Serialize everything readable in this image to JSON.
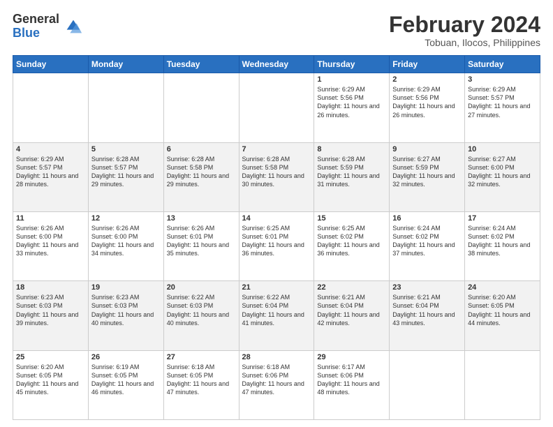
{
  "logo": {
    "general": "General",
    "blue": "Blue"
  },
  "header": {
    "month": "February 2024",
    "location": "Tobuan, Ilocos, Philippines"
  },
  "weekdays": [
    "Sunday",
    "Monday",
    "Tuesday",
    "Wednesday",
    "Thursday",
    "Friday",
    "Saturday"
  ],
  "weeks": [
    [
      {
        "day": "",
        "sunrise": "",
        "sunset": "",
        "daylight": ""
      },
      {
        "day": "",
        "sunrise": "",
        "sunset": "",
        "daylight": ""
      },
      {
        "day": "",
        "sunrise": "",
        "sunset": "",
        "daylight": ""
      },
      {
        "day": "",
        "sunrise": "",
        "sunset": "",
        "daylight": ""
      },
      {
        "day": "1",
        "sunrise": "Sunrise: 6:29 AM",
        "sunset": "Sunset: 5:56 PM",
        "daylight": "Daylight: 11 hours and 26 minutes."
      },
      {
        "day": "2",
        "sunrise": "Sunrise: 6:29 AM",
        "sunset": "Sunset: 5:56 PM",
        "daylight": "Daylight: 11 hours and 26 minutes."
      },
      {
        "day": "3",
        "sunrise": "Sunrise: 6:29 AM",
        "sunset": "Sunset: 5:57 PM",
        "daylight": "Daylight: 11 hours and 27 minutes."
      }
    ],
    [
      {
        "day": "4",
        "sunrise": "Sunrise: 6:29 AM",
        "sunset": "Sunset: 5:57 PM",
        "daylight": "Daylight: 11 hours and 28 minutes."
      },
      {
        "day": "5",
        "sunrise": "Sunrise: 6:28 AM",
        "sunset": "Sunset: 5:57 PM",
        "daylight": "Daylight: 11 hours and 29 minutes."
      },
      {
        "day": "6",
        "sunrise": "Sunrise: 6:28 AM",
        "sunset": "Sunset: 5:58 PM",
        "daylight": "Daylight: 11 hours and 29 minutes."
      },
      {
        "day": "7",
        "sunrise": "Sunrise: 6:28 AM",
        "sunset": "Sunset: 5:58 PM",
        "daylight": "Daylight: 11 hours and 30 minutes."
      },
      {
        "day": "8",
        "sunrise": "Sunrise: 6:28 AM",
        "sunset": "Sunset: 5:59 PM",
        "daylight": "Daylight: 11 hours and 31 minutes."
      },
      {
        "day": "9",
        "sunrise": "Sunrise: 6:27 AM",
        "sunset": "Sunset: 5:59 PM",
        "daylight": "Daylight: 11 hours and 32 minutes."
      },
      {
        "day": "10",
        "sunrise": "Sunrise: 6:27 AM",
        "sunset": "Sunset: 6:00 PM",
        "daylight": "Daylight: 11 hours and 32 minutes."
      }
    ],
    [
      {
        "day": "11",
        "sunrise": "Sunrise: 6:26 AM",
        "sunset": "Sunset: 6:00 PM",
        "daylight": "Daylight: 11 hours and 33 minutes."
      },
      {
        "day": "12",
        "sunrise": "Sunrise: 6:26 AM",
        "sunset": "Sunset: 6:00 PM",
        "daylight": "Daylight: 11 hours and 34 minutes."
      },
      {
        "day": "13",
        "sunrise": "Sunrise: 6:26 AM",
        "sunset": "Sunset: 6:01 PM",
        "daylight": "Daylight: 11 hours and 35 minutes."
      },
      {
        "day": "14",
        "sunrise": "Sunrise: 6:25 AM",
        "sunset": "Sunset: 6:01 PM",
        "daylight": "Daylight: 11 hours and 36 minutes."
      },
      {
        "day": "15",
        "sunrise": "Sunrise: 6:25 AM",
        "sunset": "Sunset: 6:02 PM",
        "daylight": "Daylight: 11 hours and 36 minutes."
      },
      {
        "day": "16",
        "sunrise": "Sunrise: 6:24 AM",
        "sunset": "Sunset: 6:02 PM",
        "daylight": "Daylight: 11 hours and 37 minutes."
      },
      {
        "day": "17",
        "sunrise": "Sunrise: 6:24 AM",
        "sunset": "Sunset: 6:02 PM",
        "daylight": "Daylight: 11 hours and 38 minutes."
      }
    ],
    [
      {
        "day": "18",
        "sunrise": "Sunrise: 6:23 AM",
        "sunset": "Sunset: 6:03 PM",
        "daylight": "Daylight: 11 hours and 39 minutes."
      },
      {
        "day": "19",
        "sunrise": "Sunrise: 6:23 AM",
        "sunset": "Sunset: 6:03 PM",
        "daylight": "Daylight: 11 hours and 40 minutes."
      },
      {
        "day": "20",
        "sunrise": "Sunrise: 6:22 AM",
        "sunset": "Sunset: 6:03 PM",
        "daylight": "Daylight: 11 hours and 40 minutes."
      },
      {
        "day": "21",
        "sunrise": "Sunrise: 6:22 AM",
        "sunset": "Sunset: 6:04 PM",
        "daylight": "Daylight: 11 hours and 41 minutes."
      },
      {
        "day": "22",
        "sunrise": "Sunrise: 6:21 AM",
        "sunset": "Sunset: 6:04 PM",
        "daylight": "Daylight: 11 hours and 42 minutes."
      },
      {
        "day": "23",
        "sunrise": "Sunrise: 6:21 AM",
        "sunset": "Sunset: 6:04 PM",
        "daylight": "Daylight: 11 hours and 43 minutes."
      },
      {
        "day": "24",
        "sunrise": "Sunrise: 6:20 AM",
        "sunset": "Sunset: 6:05 PM",
        "daylight": "Daylight: 11 hours and 44 minutes."
      }
    ],
    [
      {
        "day": "25",
        "sunrise": "Sunrise: 6:20 AM",
        "sunset": "Sunset: 6:05 PM",
        "daylight": "Daylight: 11 hours and 45 minutes."
      },
      {
        "day": "26",
        "sunrise": "Sunrise: 6:19 AM",
        "sunset": "Sunset: 6:05 PM",
        "daylight": "Daylight: 11 hours and 46 minutes."
      },
      {
        "day": "27",
        "sunrise": "Sunrise: 6:18 AM",
        "sunset": "Sunset: 6:05 PM",
        "daylight": "Daylight: 11 hours and 47 minutes."
      },
      {
        "day": "28",
        "sunrise": "Sunrise: 6:18 AM",
        "sunset": "Sunset: 6:06 PM",
        "daylight": "Daylight: 11 hours and 47 minutes."
      },
      {
        "day": "29",
        "sunrise": "Sunrise: 6:17 AM",
        "sunset": "Sunset: 6:06 PM",
        "daylight": "Daylight: 11 hours and 48 minutes."
      },
      {
        "day": "",
        "sunrise": "",
        "sunset": "",
        "daylight": ""
      },
      {
        "day": "",
        "sunrise": "",
        "sunset": "",
        "daylight": ""
      }
    ]
  ]
}
